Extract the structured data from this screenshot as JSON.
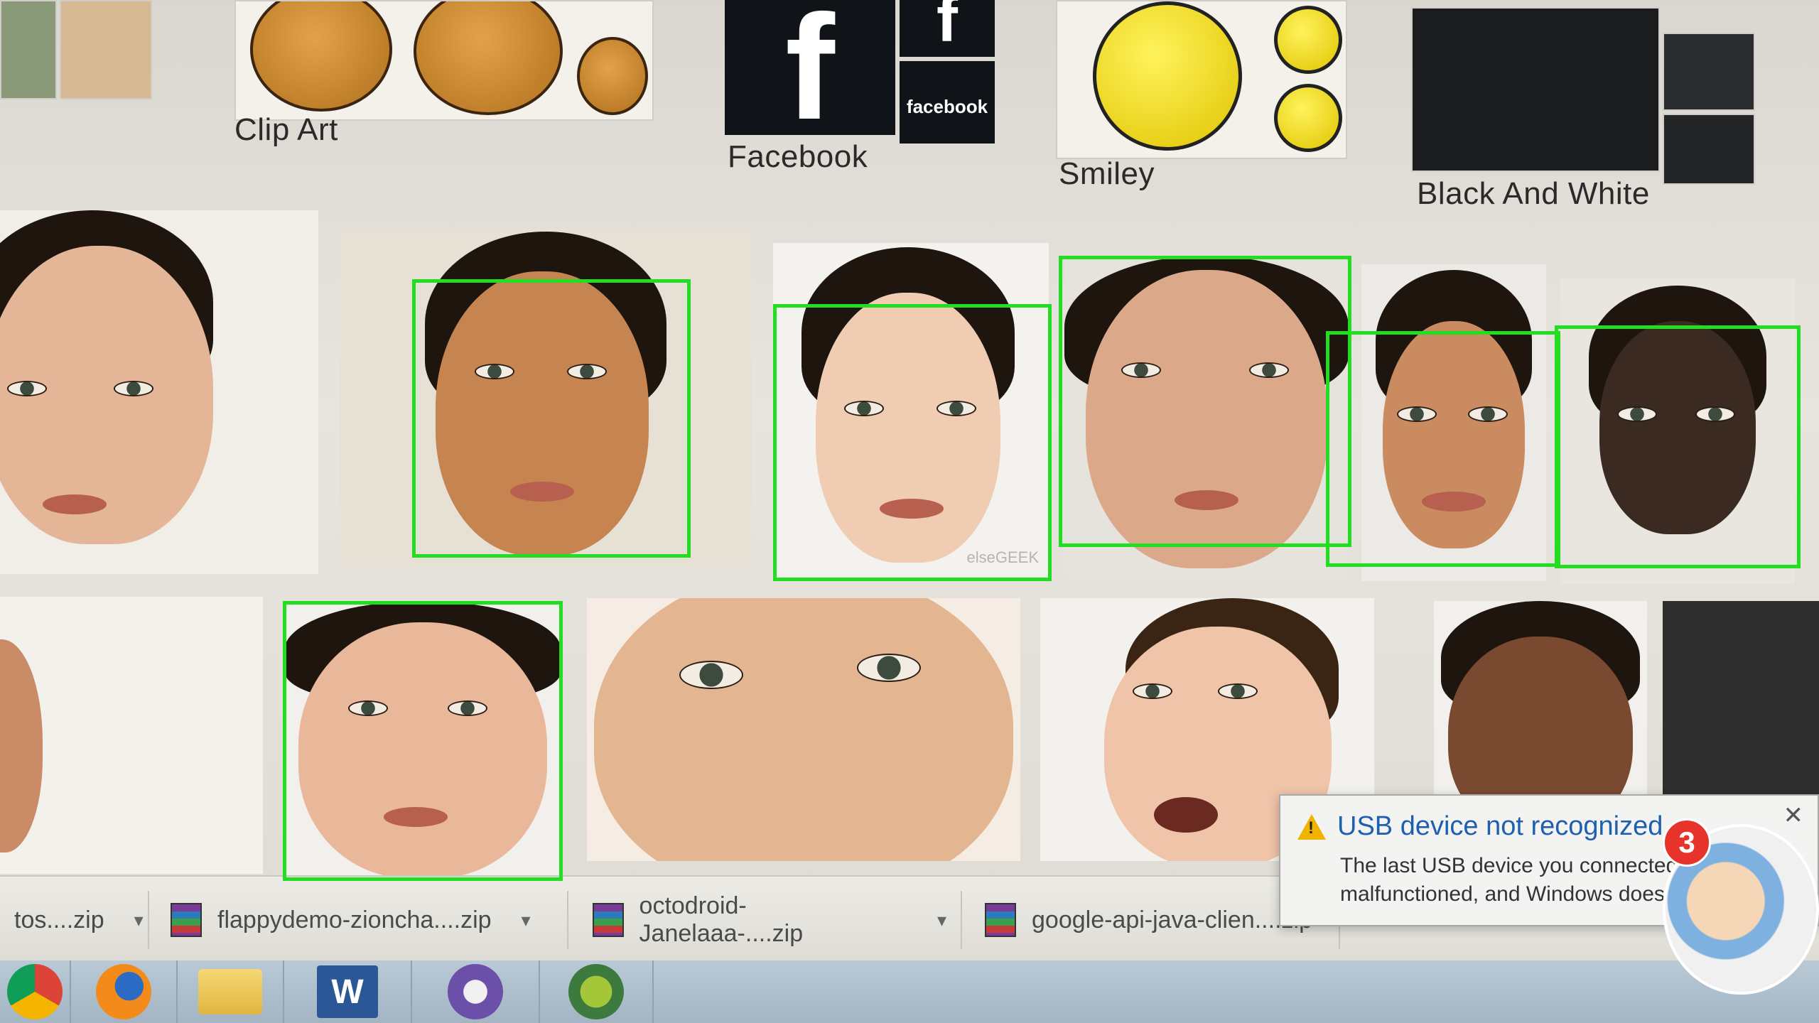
{
  "categories": [
    {
      "label": "Clip Art"
    },
    {
      "label": "Facebook",
      "tile_text": "facebook"
    },
    {
      "label": "Smiley"
    },
    {
      "label": "Black And White"
    }
  ],
  "photo_watermark": "elseGEEK",
  "downloads": [
    {
      "name": "tos....zip"
    },
    {
      "name": "flappydemo-zioncha....zip"
    },
    {
      "name": "octodroid-Janelaaa-....zip"
    },
    {
      "name": "google-api-java-clien....zip"
    }
  ],
  "notification": {
    "title": "USB device not recognized",
    "line1": "The last USB device you connected to th",
    "line2": "malfunctioned, and Windows does not",
    "close": "✕"
  },
  "chat_badge": "3",
  "taskbar": {
    "icons": [
      "chrome-icon",
      "firefox-icon",
      "folder-icon",
      "word-icon",
      "github-icon",
      "android-studio-icon"
    ],
    "word_letter": "W"
  },
  "colors": {
    "detection_box": "#22dd22",
    "notification_title": "#1f5fb0",
    "badge": "#e8332b"
  }
}
